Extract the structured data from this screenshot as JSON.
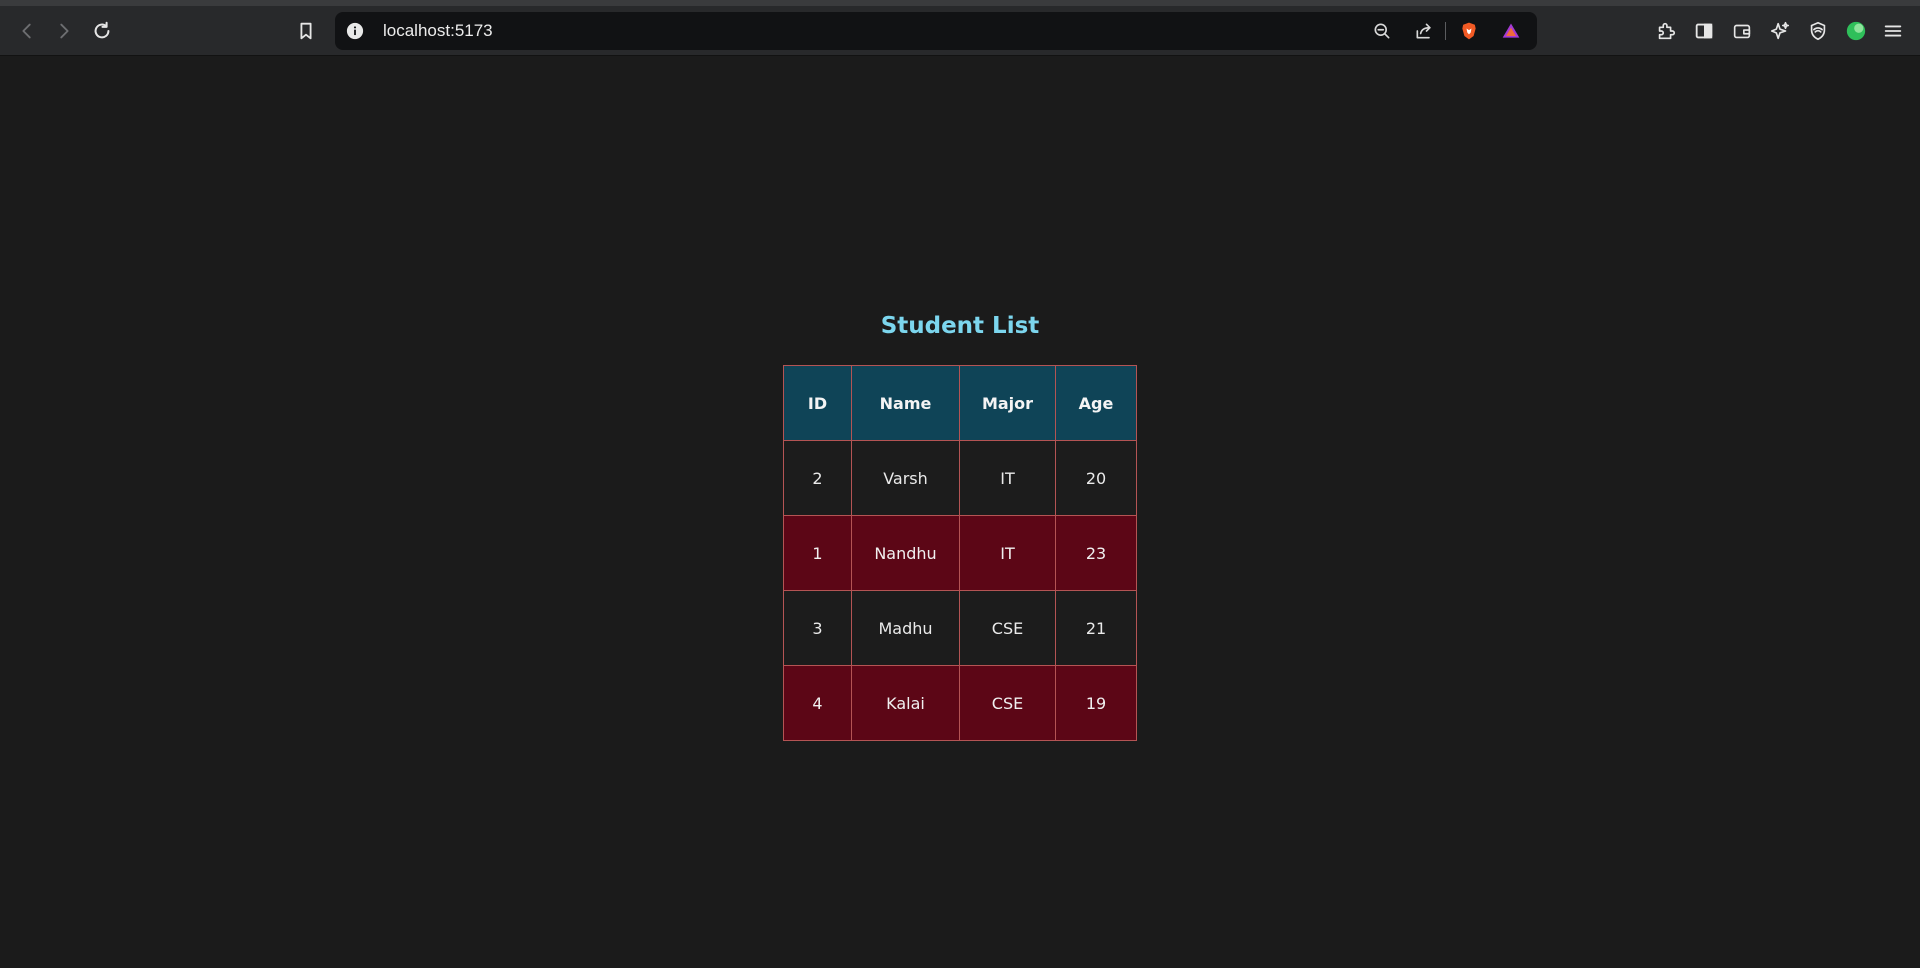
{
  "browser": {
    "url": "localhost:5173"
  },
  "page": {
    "title": "Student List"
  },
  "table": {
    "headers": [
      "ID",
      "Name",
      "Major",
      "Age"
    ],
    "rows": [
      [
        "2",
        "Varsh",
        "IT",
        "20"
      ],
      [
        "1",
        "Nandhu",
        "IT",
        "23"
      ],
      [
        "3",
        "Madhu",
        "CSE",
        "21"
      ],
      [
        "4",
        "Kalai",
        "CSE",
        "19"
      ]
    ]
  },
  "icons": {
    "back": "back-arrow-icon",
    "forward": "forward-arrow-icon",
    "reload": "reload-icon",
    "bookmark": "bookmark-icon",
    "info": "info-icon",
    "zoom": "zoom-out-icon",
    "share": "share-icon",
    "brave": "brave-shield-icon",
    "rewards": "brave-rewards-icon",
    "extensions": "extensions-icon",
    "sidebar": "sidebar-icon",
    "wallet": "wallet-icon",
    "leo": "leo-ai-icon",
    "vpn": "vpn-icon",
    "profile": "profile-icon",
    "menu": "menu-icon"
  },
  "colors": {
    "page_bg": "#1b1b1b",
    "title": "#7cd6ee",
    "header_bg": "#0f4457",
    "row_alt_bg": "#5c0616",
    "border": "#b45454"
  }
}
